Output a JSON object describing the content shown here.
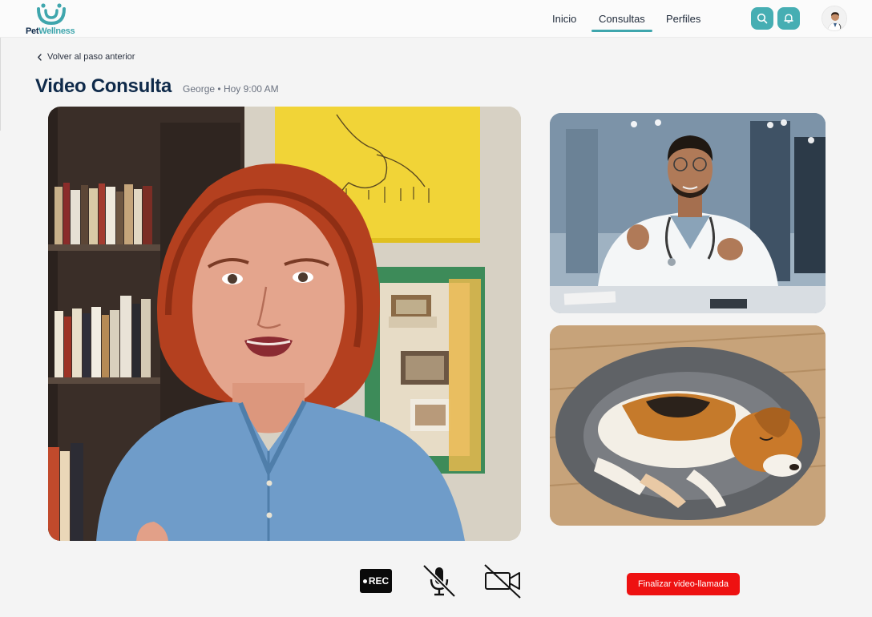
{
  "app": {
    "logo_part1": "Pet",
    "logo_part2": "Wellness"
  },
  "nav": {
    "items": [
      {
        "label": "Inicio",
        "active": false
      },
      {
        "label": "Consultas",
        "active": true
      },
      {
        "label": "Perfiles",
        "active": false
      }
    ]
  },
  "header_icons": [
    "search-icon",
    "bell-icon"
  ],
  "page": {
    "back_label": "Volver al paso anterior",
    "title": "Video Consulta",
    "subtitle": "George • Hoy 9:00 AM"
  },
  "controls": {
    "rec_label": "REC",
    "end_call_label": "Finalizar video-llamada",
    "mic_state": "muted",
    "camera_state": "off"
  },
  "colors": {
    "brand_teal": "#46aeb3",
    "brand_navy": "#0f2a4a",
    "end_call_red": "#ee1111"
  }
}
